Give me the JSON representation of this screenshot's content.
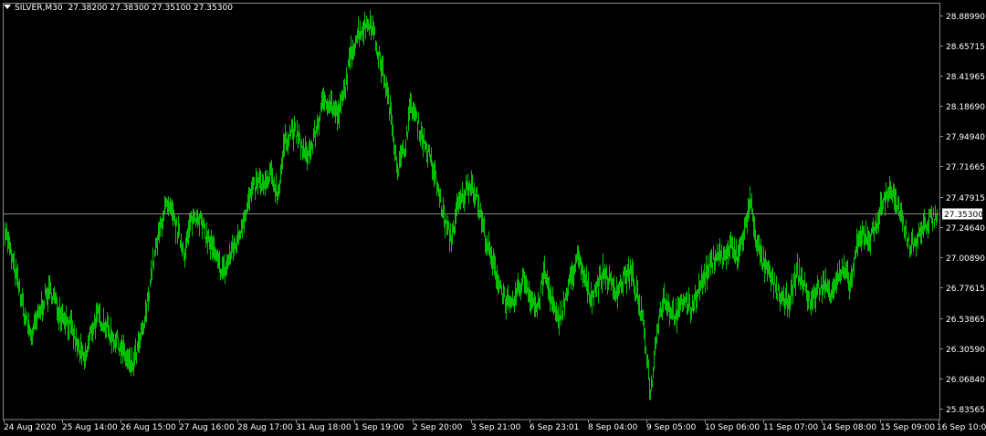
{
  "header": {
    "symbol": "SILVER,M30",
    "ohlc": "27.38200 27.38300 27.35100 27.35300"
  },
  "colors": {
    "background": "#000000",
    "bars": "#00c000",
    "frame": "#8a8a8a",
    "text": "#ffffff",
    "price_line": "#8c8c8c",
    "price_label_bg": "#ffffff",
    "price_label_text": "#000000"
  },
  "chart_data": {
    "type": "line",
    "ylim": [
      25.75,
      28.98
    ],
    "y_ticks": [
      "28.88990",
      "28.65715",
      "28.41965",
      "28.18690",
      "27.94940",
      "27.71665",
      "27.47915",
      "27.24640",
      "27.00890",
      "26.77615",
      "26.53865",
      "26.30590",
      "26.06840",
      "25.83565"
    ],
    "x_ticks": [
      "24 Aug 2020",
      "25 Aug 14:00",
      "26 Aug 15:00",
      "27 Aug 16:00",
      "28 Aug 17:00",
      "31 Aug 18:00",
      "1 Sep 19:00",
      "2 Sep 20:00",
      "3 Sep 21:00",
      "6 Sep 23:01",
      "8 Sep 04:00",
      "9 Sep 05:00",
      "10 Sep 06:00",
      "11 Sep 07:00",
      "14 Sep 08:00",
      "15 Sep 09:00",
      "16 Sep 10:00"
    ],
    "current_price": "27.35300",
    "series": [
      {
        "style": "bars",
        "values": [
          27.25,
          27.0,
          26.8,
          26.55,
          26.4,
          26.55,
          26.7,
          26.75,
          26.6,
          26.55,
          26.45,
          26.3,
          26.2,
          26.45,
          26.55,
          26.5,
          26.4,
          26.35,
          26.25,
          26.15,
          26.3,
          26.5,
          26.9,
          27.15,
          27.4,
          27.35,
          27.2,
          27.05,
          27.3,
          27.35,
          27.2,
          27.1,
          26.95,
          26.9,
          27.05,
          27.15,
          27.35,
          27.5,
          27.6,
          27.55,
          27.65,
          27.5,
          27.9,
          28.0,
          27.95,
          27.8,
          27.85,
          28.05,
          28.25,
          28.2,
          28.1,
          28.3,
          28.6,
          28.75,
          28.8,
          28.85,
          28.6,
          28.4,
          28.1,
          27.7,
          27.85,
          28.2,
          28.05,
          27.9,
          27.75,
          27.55,
          27.3,
          27.15,
          27.4,
          27.5,
          27.6,
          27.45,
          27.2,
          27.0,
          26.85,
          26.7,
          26.6,
          26.75,
          26.85,
          26.7,
          26.6,
          26.9,
          26.7,
          26.5,
          26.65,
          26.85,
          27.0,
          26.85,
          26.7,
          26.8,
          26.9,
          26.8,
          26.75,
          26.85,
          26.9,
          26.7,
          26.45,
          25.95,
          26.5,
          26.7,
          26.6,
          26.55,
          26.7,
          26.6,
          26.75,
          26.85,
          26.95,
          27.05,
          27.0,
          27.1,
          27.0,
          27.2,
          27.45,
          27.1,
          26.95,
          26.85,
          26.75,
          26.65,
          26.7,
          26.9,
          26.8,
          26.65,
          26.75,
          26.8,
          26.75,
          26.85,
          26.9,
          26.8,
          27.1,
          27.2,
          27.15,
          27.3,
          27.45,
          27.55,
          27.4,
          27.25,
          27.1,
          27.15,
          27.25,
          27.3,
          27.35
        ]
      }
    ]
  }
}
